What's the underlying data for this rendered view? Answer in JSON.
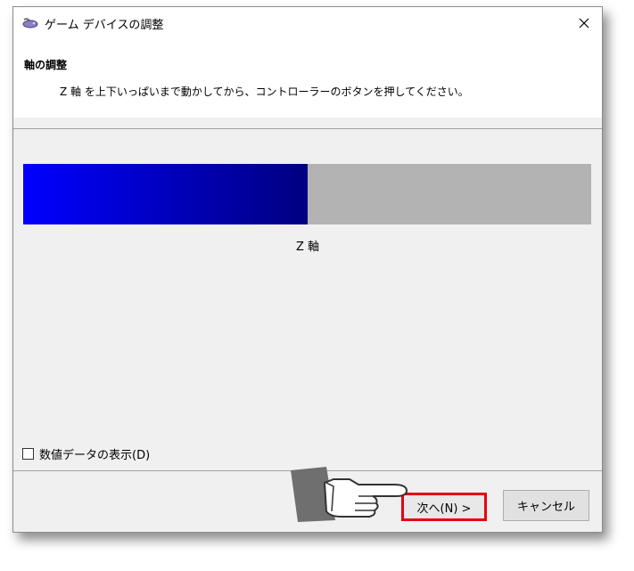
{
  "window": {
    "title": "ゲーム デバイスの調整",
    "close_glyph": "✕"
  },
  "header": {
    "title": "軸の調整",
    "instruction": "Z 軸 を上下いっぱいまで動かしてから、コントローラーのボタンを押してください。"
  },
  "axis": {
    "label": "Z 軸",
    "level": 0.5,
    "fill_color_start": "#0000ff",
    "fill_color_end": "#000080",
    "track_color": "#b3b3b3"
  },
  "options": {
    "show_values_label": "数値データの表示(D)",
    "show_values_checked": false
  },
  "buttons": {
    "next_label": "次へ(N) >",
    "cancel_label": "キャンセル"
  },
  "annotations": {
    "highlight_color": "#e60012",
    "pointer_icon": "pointing-hand-icon"
  }
}
